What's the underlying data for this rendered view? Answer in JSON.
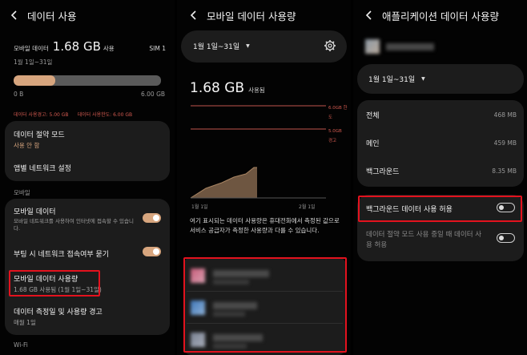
{
  "panel1": {
    "title": "데이터 사용",
    "mobile_label": "모바일 데이터",
    "usage_big": "1.68 GB",
    "usage_suffix": "사용",
    "sim": "SIM 1",
    "period": "1월 1일~31일",
    "bar_min": "0 B",
    "bar_max": "6.00 GB",
    "usage_fraction": 0.28,
    "warn_line": "데이터 사용경고: 5.00 GB",
    "limit_line": "데이터 사용한도: 6.00 GB",
    "saver_title": "데이터 절약 모드",
    "saver_state": "사용 안 함",
    "app_net": "앱별 네트워크 설정",
    "section_mobile": "모바일",
    "mobile_data_title": "모바일 데이터",
    "mobile_data_desc": "모바일 네트워크를 사용하여 인터넷에 접속할 수 있습니다.",
    "roaming_title": "부팅 시 네트워크 접속여부 묻기",
    "usage_item_title": "모바일 데이터 사용량",
    "usage_item_desc": "1.68 GB 사용됨 (1월 1일~31일)",
    "cycle_title": "데이터 측정일 및 사용량 경고",
    "cycle_desc": "매월 1일",
    "section_wifi": "Wi-Fi"
  },
  "panel2": {
    "title": "모바일 데이터 사용량",
    "period": "1월 1일~31일",
    "used_big": "1.68 GB",
    "used_suffix": "사용됨",
    "limit_label": "6.0GB 한도",
    "warn_label": "5.0GB 경고",
    "x_start": "1월 1일",
    "x_end": "2월 1일",
    "note": "여기 표시되는 데이터 사용량은 휴대전화에서 측정된 값으로 서비스 공급자가 측정한 사용량과 다를 수 있습니다.",
    "apps": [
      {
        "color": "#c75d7a",
        "accent": "#d99fb0"
      },
      {
        "color": "#3f77b8",
        "accent": "#8fb2d8"
      },
      {
        "color": "#7a8294",
        "accent": "#a7acb8"
      }
    ]
  },
  "panel3": {
    "title": "애플리케이션 데이터 사용량",
    "period": "1월 1일~31일",
    "rows": [
      {
        "label": "전체",
        "value": "468 MB"
      },
      {
        "label": "메인",
        "value": "459 MB"
      },
      {
        "label": "백그라운드",
        "value": "8.35 MB"
      }
    ],
    "bg_toggle": "백그라운드 데이터 사용 허용",
    "saver_toggle": "데이터 절약 모드 사용 중일 때 데이터 사용 허용"
  },
  "colors": {
    "accent": "#d7a57e",
    "highlight": "#e3121e",
    "warning_line": "#c2564c"
  }
}
